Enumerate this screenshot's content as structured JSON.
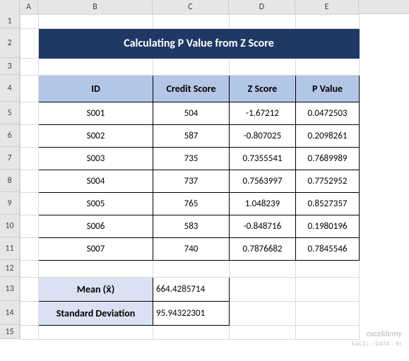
{
  "columns": [
    "A",
    "B",
    "C",
    "D",
    "E"
  ],
  "colWidths": {
    "A": 26,
    "B": 162,
    "C": 108,
    "D": 94,
    "E": 90
  },
  "rowHeights": {
    "1": 20,
    "2": 42,
    "3": 24,
    "4": 38,
    "5": 32,
    "6": 32,
    "7": 32,
    "8": 32,
    "9": 32,
    "10": 32,
    "11": 32,
    "12": 24,
    "13": 34,
    "14": 34,
    "15": 20
  },
  "title": "Calculating P Value from Z Score",
  "headers": {
    "id": "ID",
    "credit": "Credit Score",
    "z": "Z Score",
    "p": "P Value"
  },
  "rows": [
    {
      "id": "S001",
      "credit": "504",
      "z": "-1.67212",
      "p": "0.0472503"
    },
    {
      "id": "S002",
      "credit": "587",
      "z": "-0.807025",
      "p": "0.2098261"
    },
    {
      "id": "S003",
      "credit": "735",
      "z": "0.7355541",
      "p": "0.7689989"
    },
    {
      "id": "S004",
      "credit": "737",
      "z": "0.7563997",
      "p": "0.7752952"
    },
    {
      "id": "S005",
      "credit": "765",
      "z": "1.048239",
      "p": "0.8527357"
    },
    {
      "id": "S006",
      "credit": "583",
      "z": "-0.848716",
      "p": "0.1980196"
    },
    {
      "id": "S007",
      "credit": "740",
      "z": "0.7876682",
      "p": "0.7845546"
    }
  ],
  "stats": {
    "meanLabel": "Mean (x̄)",
    "meanValue": "664.4285714",
    "sdLabel": "Standard Deviation",
    "sdValue": "95.94322301"
  },
  "watermark": {
    "main": "exceldemy",
    "sub": "EXCEL · DATA · BI"
  },
  "chart_data": {
    "type": "table",
    "title": "Calculating P Value from Z Score",
    "columns": [
      "ID",
      "Credit Score",
      "Z Score",
      "P Value"
    ],
    "rows": [
      [
        "S001",
        504,
        -1.67212,
        0.0472503
      ],
      [
        "S002",
        587,
        -0.807025,
        0.2098261
      ],
      [
        "S003",
        735,
        0.7355541,
        0.7689989
      ],
      [
        "S004",
        737,
        0.7563997,
        0.7752952
      ],
      [
        "S005",
        765,
        1.048239,
        0.8527357
      ],
      [
        "S006",
        583,
        -0.848716,
        0.1980196
      ],
      [
        "S007",
        740,
        0.7876682,
        0.7845546
      ]
    ],
    "summary": {
      "Mean": 664.4285714,
      "Standard Deviation": 95.94322301
    }
  }
}
